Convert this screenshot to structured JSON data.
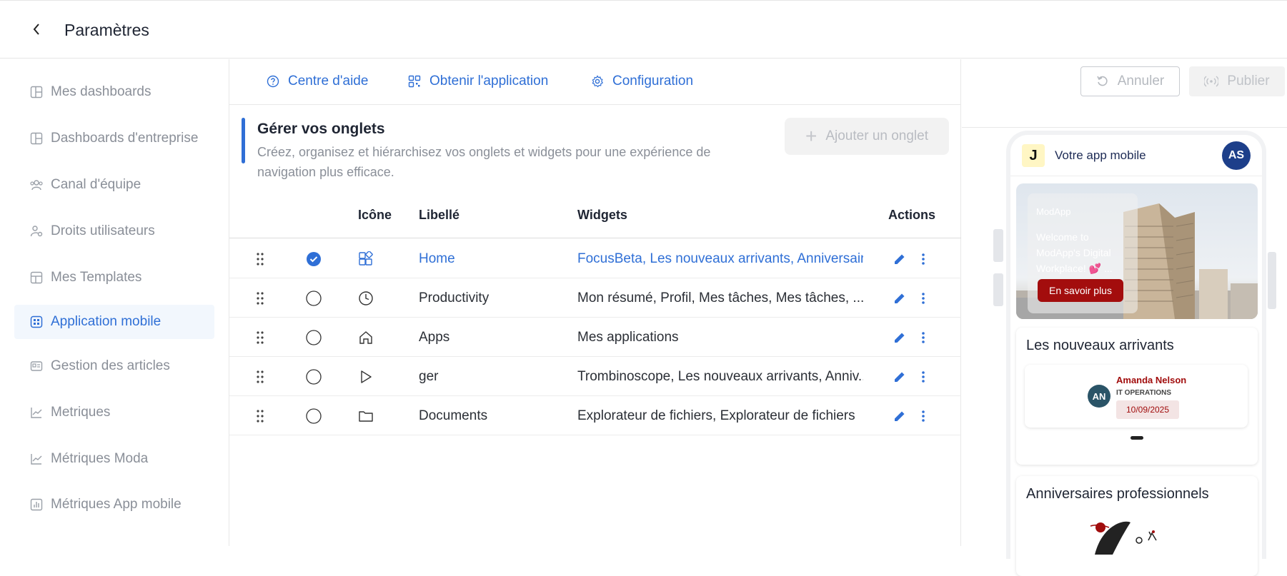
{
  "header": {
    "title": "Paramètres"
  },
  "sidebar": {
    "items": [
      {
        "label": "Mes dashboards",
        "icon": "dashboard-icon",
        "active": false
      },
      {
        "label": "Dashboards d'entreprise",
        "icon": "dashboard-icon",
        "active": false
      },
      {
        "label": "Canal d'équipe",
        "icon": "team-icon",
        "active": false
      },
      {
        "label": "Droits utilisateurs",
        "icon": "user-rights-icon",
        "active": false
      },
      {
        "label": "Mes Templates",
        "icon": "template-icon",
        "active": false
      },
      {
        "label": "Application mobile",
        "icon": "mobile-app-icon",
        "active": true
      },
      {
        "label": "Gestion des articles",
        "icon": "articles-icon",
        "active": false
      },
      {
        "label": "Metriques",
        "icon": "chart-icon",
        "active": false
      },
      {
        "label": "Métriques Moda",
        "icon": "chart-icon",
        "active": false
      },
      {
        "label": "Métriques App mobile",
        "icon": "bar-chart-icon",
        "active": false
      }
    ]
  },
  "toolbar": {
    "help": "Centre d'aide",
    "get_app": "Obtenir l'application",
    "config": "Configuration"
  },
  "manage": {
    "title": "Gérer vos onglets",
    "description": "Créez, organisez et hiérarchisez vos onglets et widgets pour une expérience de navigation plus efficace.",
    "add_button": "Ajouter un onglet"
  },
  "table": {
    "headers": {
      "icon": "Icône",
      "label": "Libellé",
      "widgets": "Widgets",
      "actions": "Actions"
    },
    "rows": [
      {
        "label": "Home",
        "widgets": "FocusBeta, Les nouveaux arrivants, Anniversair...",
        "icon": "grid-plus-icon",
        "selected": true
      },
      {
        "label": "Productivity",
        "widgets": "Mon résumé, Profil, Mes tâches, Mes tâches, ...",
        "icon": "clock-icon",
        "selected": false
      },
      {
        "label": "Apps",
        "widgets": "Mes applications",
        "icon": "home-icon",
        "selected": false
      },
      {
        "label": "ger",
        "widgets": "Trombinoscope, Les nouveaux arrivants, Anniv...",
        "icon": "play-icon",
        "selected": false
      },
      {
        "label": "Documents",
        "widgets": "Explorateur de fichiers, Explorateur de fichiers",
        "icon": "folder-icon",
        "selected": false
      }
    ]
  },
  "preview": {
    "cancel": "Annuler",
    "publish": "Publier",
    "app_logo": "J",
    "app_title": "Votre app mobile",
    "avatar": "AS",
    "banner": {
      "brand": "ModApp",
      "text": "Welcome to ModApp's Digital Workplace! 💕 ...",
      "button": "En savoir plus"
    },
    "newcomers": {
      "title": "Les nouveaux arrivants",
      "initials": "AN",
      "name": "Amanda Nelson",
      "department": "IT OPERATIONS",
      "date": "10/09/2025"
    },
    "anniversaries": {
      "title": "Anniversaires professionnels"
    }
  },
  "colors": {
    "accent": "#2f6fd6",
    "brand_red": "#a30d0d",
    "avatar_blue": "#1d3f8a"
  }
}
